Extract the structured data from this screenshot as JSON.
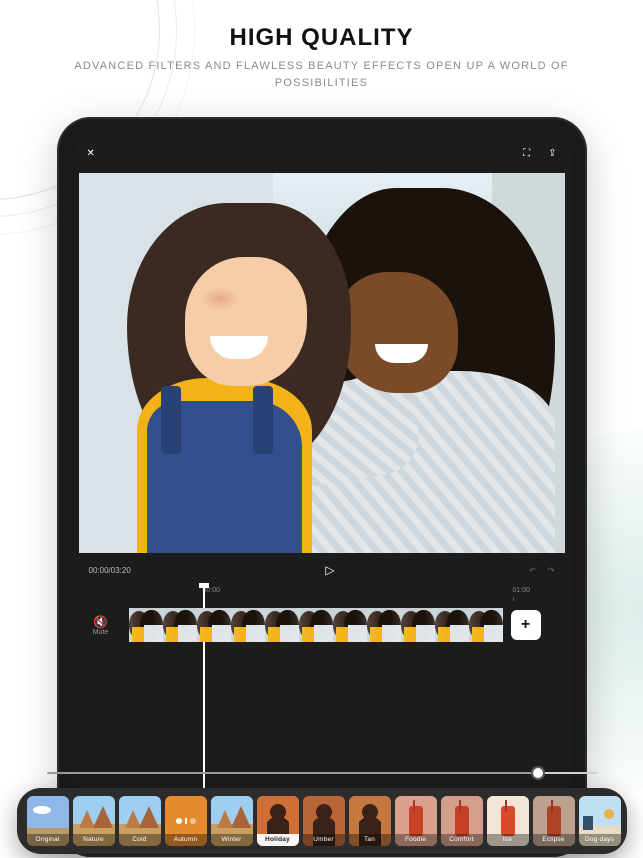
{
  "hero": {
    "title": "HIGH QUALITY",
    "subtitle": "ADVANCED FILTERS AND FLAWLESS BEAUTY EFFECTS OPEN UP A WORLD OF POSSIBILITIES"
  },
  "topbar": {
    "close": "✕",
    "fullscreen": "⛶",
    "export": "⇪"
  },
  "playback": {
    "time": "00:00/03:20",
    "play": "▷",
    "undo": "↶",
    "redo": "↷"
  },
  "timeline": {
    "mute_icon": "🔇",
    "mute_label": "Mute",
    "ruler": [
      "00:00",
      "01:00"
    ],
    "clip_count": 11,
    "add": "+"
  },
  "filters": {
    "items": [
      {
        "label": "Original",
        "tint": "",
        "scene": "sky",
        "selected": false
      },
      {
        "label": "Nature",
        "tint": "",
        "scene": "mesa",
        "selected": false
      },
      {
        "label": "Cold",
        "tint": "",
        "scene": "mesa",
        "selected": false
      },
      {
        "label": "Autumn",
        "tint": "#e38b2d",
        "scene": "solid",
        "selected": false
      },
      {
        "label": "Winter",
        "tint": "",
        "scene": "mesa",
        "selected": false
      },
      {
        "label": "Holiday",
        "tint": "#c65a2a",
        "scene": "man",
        "selected": true
      },
      {
        "label": "Umber",
        "tint": "#9a4a24",
        "scene": "man",
        "selected": false
      },
      {
        "label": "Tan",
        "tint": "#b06a38",
        "scene": "man",
        "selected": false
      },
      {
        "label": "Foodie",
        "tint": "#b23a22",
        "scene": "drink",
        "selected": false
      },
      {
        "label": "Comfort",
        "tint": "#a3321e",
        "scene": "drink",
        "selected": false
      },
      {
        "label": "Ice",
        "tint": "",
        "scene": "drink",
        "selected": false
      },
      {
        "label": "Eclipse",
        "tint": "#6b3a22",
        "scene": "drink",
        "selected": false
      },
      {
        "label": "Dog days",
        "tint": "",
        "scene": "beach",
        "selected": false
      }
    ]
  }
}
